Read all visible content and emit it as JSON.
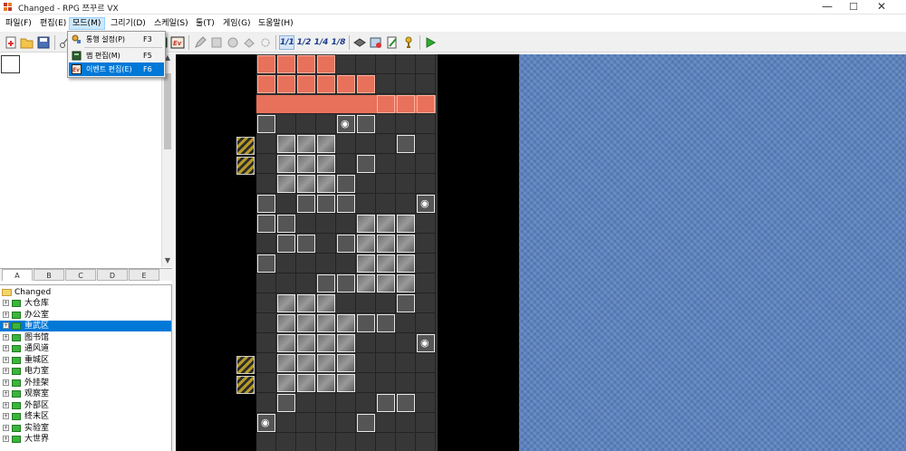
{
  "window": {
    "title": "Changed - RPG 쯔꾸르 VX",
    "minimize_glyph": "—",
    "maximize_glyph": "☐",
    "close_glyph": "✕"
  },
  "menubar": {
    "items": [
      {
        "label": "파일(F)"
      },
      {
        "label": "편집(E)"
      },
      {
        "label": "모드(M)"
      },
      {
        "label": "그리기(D)"
      },
      {
        "label": "스케일(S)"
      },
      {
        "label": "툴(T)"
      },
      {
        "label": "게임(G)"
      },
      {
        "label": "도움말(H)"
      }
    ],
    "active_index": 2
  },
  "mode_menu": {
    "items": [
      {
        "label": "통행 설정(P)",
        "shortcut": "F3",
        "icon": "passage-icon"
      },
      {
        "label": "맵 편집(M)",
        "shortcut": "F5",
        "icon": "map-edit-icon"
      },
      {
        "label": "이벤트 편집(E)",
        "shortcut": "F6",
        "icon": "event-edit-icon"
      }
    ],
    "highlighted_index": 2
  },
  "toolbar": {
    "scales": [
      "1/1",
      "1/2",
      "1/4",
      "1/8"
    ],
    "active_scale": "1/1",
    "icons": [
      "new-project-icon",
      "open-project-icon",
      "save-icon",
      "cut-icon",
      "database-icon",
      "event-mode-icon",
      "pencil-icon",
      "rectangle-icon",
      "ellipse-icon",
      "fill-icon",
      "select-icon",
      "layer-icon",
      "script-editor-icon",
      "sound-test-icon",
      "resource-icon",
      "play-test-icon"
    ]
  },
  "tileset_tabs": [
    "A",
    "B",
    "C",
    "D",
    "E"
  ],
  "active_tab": "A",
  "map_tree": {
    "root": "Changed",
    "maps": [
      "大仓库",
      "办公室",
      "重武区",
      "图书馆",
      "通风道",
      "重城区",
      "电力室",
      "外挂架",
      "观察室",
      "外部区",
      "终末区",
      "实验室",
      "大世界"
    ],
    "selected_index": 2
  },
  "colors": {
    "selection": "#0078d7",
    "water": "#5b82c0",
    "event_red": "#e8715b",
    "map_floor": "#373737"
  }
}
